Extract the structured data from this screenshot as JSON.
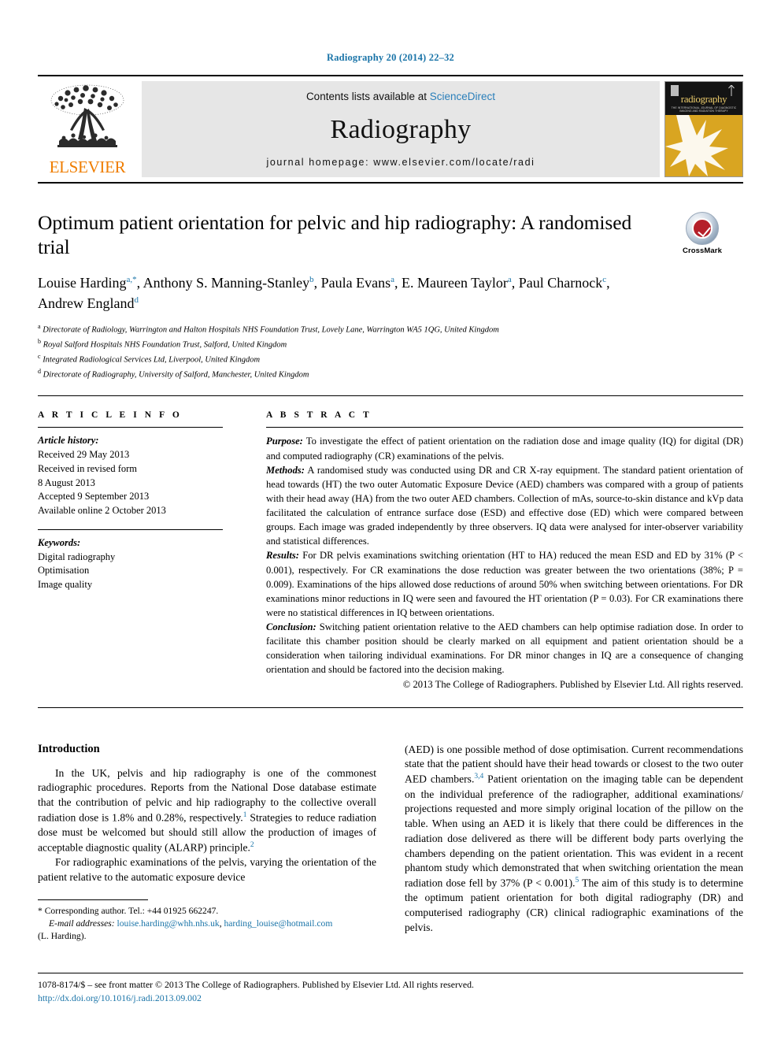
{
  "running_head": "Radiography 20 (2014) 22–32",
  "masthead": {
    "contents_prefix": "Contents lists available at ",
    "sciencedirect": "ScienceDirect",
    "journal_name": "Radiography",
    "homepage": "journal homepage: www.elsevier.com/locate/radi",
    "publisher_logo_text": "ELSEVIER",
    "cover_title": "radiography",
    "cover_subtitle": "THE INTERNATIONAL JOURNAL OF DIAGNOSTIC IMAGING AND RADIATION THERAPY"
  },
  "article": {
    "title": "Optimum patient orientation for pelvic and hip radiography: A randomised trial",
    "authors": [
      {
        "name": "Louise Harding",
        "marks": "a,",
        "star": "*",
        "sep": ", "
      },
      {
        "name": "Anthony S. Manning-Stanley",
        "marks": "b",
        "star": "",
        "sep": ", "
      },
      {
        "name": "Paula Evans",
        "marks": "a",
        "star": "",
        "sep": ", "
      },
      {
        "name": "E. Maureen Taylor",
        "marks": "a",
        "star": "",
        "sep": ", "
      },
      {
        "name": "Paul Charnock",
        "marks": "c",
        "star": "",
        "sep": ", "
      },
      {
        "name": "Andrew England",
        "marks": "d",
        "star": "",
        "sep": ""
      }
    ],
    "affiliations": [
      {
        "mark": "a",
        "text": "Directorate of Radiology, Warrington and Halton Hospitals NHS Foundation Trust, Lovely Lane, Warrington WA5 1QG, United Kingdom"
      },
      {
        "mark": "b",
        "text": "Royal Salford Hospitals NHS Foundation Trust, Salford, United Kingdom"
      },
      {
        "mark": "c",
        "text": "Integrated Radiological Services Ltd, Liverpool, United Kingdom"
      },
      {
        "mark": "d",
        "text": "Directorate of Radiography, University of Salford, Manchester, United Kingdom"
      }
    ],
    "crossmark_label": "CrossMark"
  },
  "article_info": {
    "heading": "A R T I C L E  I N F O",
    "history_label": "Article history:",
    "history": [
      "Received 29 May 2013",
      "Received in revised form",
      "8 August 2013",
      "Accepted 9 September 2013",
      "Available online 2 October 2013"
    ],
    "keywords_label": "Keywords:",
    "keywords": [
      "Digital radiography",
      "Optimisation",
      "Image quality"
    ]
  },
  "abstract": {
    "heading": "A B S T R A C T",
    "sections": [
      {
        "label": "Purpose:",
        "text": " To investigate the effect of patient orientation on the radiation dose and image quality (IQ) for digital (DR) and computed radiography (CR) examinations of the pelvis."
      },
      {
        "label": "Methods:",
        "text": " A randomised study was conducted using DR and CR X-ray equipment. The standard patient orientation of head towards (HT) the two outer Automatic Exposure Device (AED) chambers was compared with a group of patients with their head away (HA) from the two outer AED chambers. Collection of mAs, source-to-skin distance and kVp data facilitated the calculation of entrance surface dose (ESD) and effective dose (ED) which were compared between groups. Each image was graded independently by three observers. IQ data were analysed for inter-observer variability and statistical differences."
      },
      {
        "label": "Results:",
        "text": " For DR pelvis examinations switching orientation (HT to HA) reduced the mean ESD and ED by 31% (P < 0.001), respectively. For CR examinations the dose reduction was greater between the two orientations (38%; P = 0.009). Examinations of the hips allowed dose reductions of around 50% when switching between orientations. For DR examinations minor reductions in IQ were seen and favoured the HT orientation (P = 0.03). For CR examinations there were no statistical differences in IQ between orientations."
      },
      {
        "label": "Conclusion:",
        "text": " Switching patient orientation relative to the AED chambers can help optimise radiation dose. In order to facilitate this chamber position should be clearly marked on all equipment and patient orientation should be a consideration when tailoring individual examinations. For DR minor changes in IQ are a consequence of changing orientation and should be factored into the decision making."
      }
    ],
    "copyright": "© 2013 The College of Radiographers. Published by Elsevier Ltd. All rights reserved."
  },
  "body": {
    "section_title": "Introduction",
    "left_paragraphs": [
      {
        "parts": [
          {
            "t": "In the UK, pelvis and hip radiography is one of the commonest radiographic procedures. Reports from the National Dose database estimate that the contribution of pelvic and hip radiography to the collective overall radiation dose is 1.8% and 0.28%, respectively."
          },
          {
            "t": "1",
            "ref": true
          },
          {
            "t": " Strategies to reduce radiation dose must be welcomed but should still allow the production of images of acceptable diagnostic quality (ALARP) principle."
          },
          {
            "t": "2",
            "ref": true
          }
        ]
      },
      {
        "parts": [
          {
            "t": "For radiographic examinations of the pelvis, varying the orientation of the patient relative to the automatic exposure device"
          }
        ]
      }
    ],
    "right_paragraphs": [
      {
        "parts": [
          {
            "t": "(AED) is one possible method of dose optimisation. Current recommendations state that the patient should have their head towards or closest to the two outer AED chambers."
          },
          {
            "t": "3,4",
            "ref": true
          },
          {
            "t": " Patient orientation on the imaging table can be dependent on the individual preference of the radiographer, additional examinations/ projections requested and more simply original location of the pillow on the table. When using an AED it is likely that there could be differences in the radiation dose delivered as there will be different body parts overlying the chambers depending on the patient orientation. This was evident in a recent phantom study which demonstrated that when switching orientation the mean radiation dose fell by 37% (P < 0.001)."
          },
          {
            "t": "5",
            "ref": true
          },
          {
            "t": " The aim of this study is to determine the optimum patient orientation for both digital radiography (DR) and computerised radiography (CR) clinical radiographic examinations of the pelvis."
          }
        ]
      }
    ]
  },
  "footnotes": {
    "corresponding": "* Corresponding author. Tel.: +44 01925 662247.",
    "email_label": "E-mail addresses:",
    "email_1": "louise.harding@whh.nhs.uk",
    "email_sep": ", ",
    "email_2": "harding_louise@hotmail.com",
    "attribution": "(L. Harding)."
  },
  "page_footer": {
    "issn_line": "1078-8174/$ – see front matter © 2013 The College of Radiographers. Published by Elsevier Ltd. All rights reserved.",
    "doi": "http://dx.doi.org/10.1016/j.radi.2013.09.002"
  },
  "colors": {
    "link_blue": "#1a74a8",
    "sciencedirect_blue": "#2a7fba",
    "elsevier_orange": "#ef7d00",
    "crossmark_red": "#b5202a",
    "masthead_grey": "#e6e6e6"
  }
}
